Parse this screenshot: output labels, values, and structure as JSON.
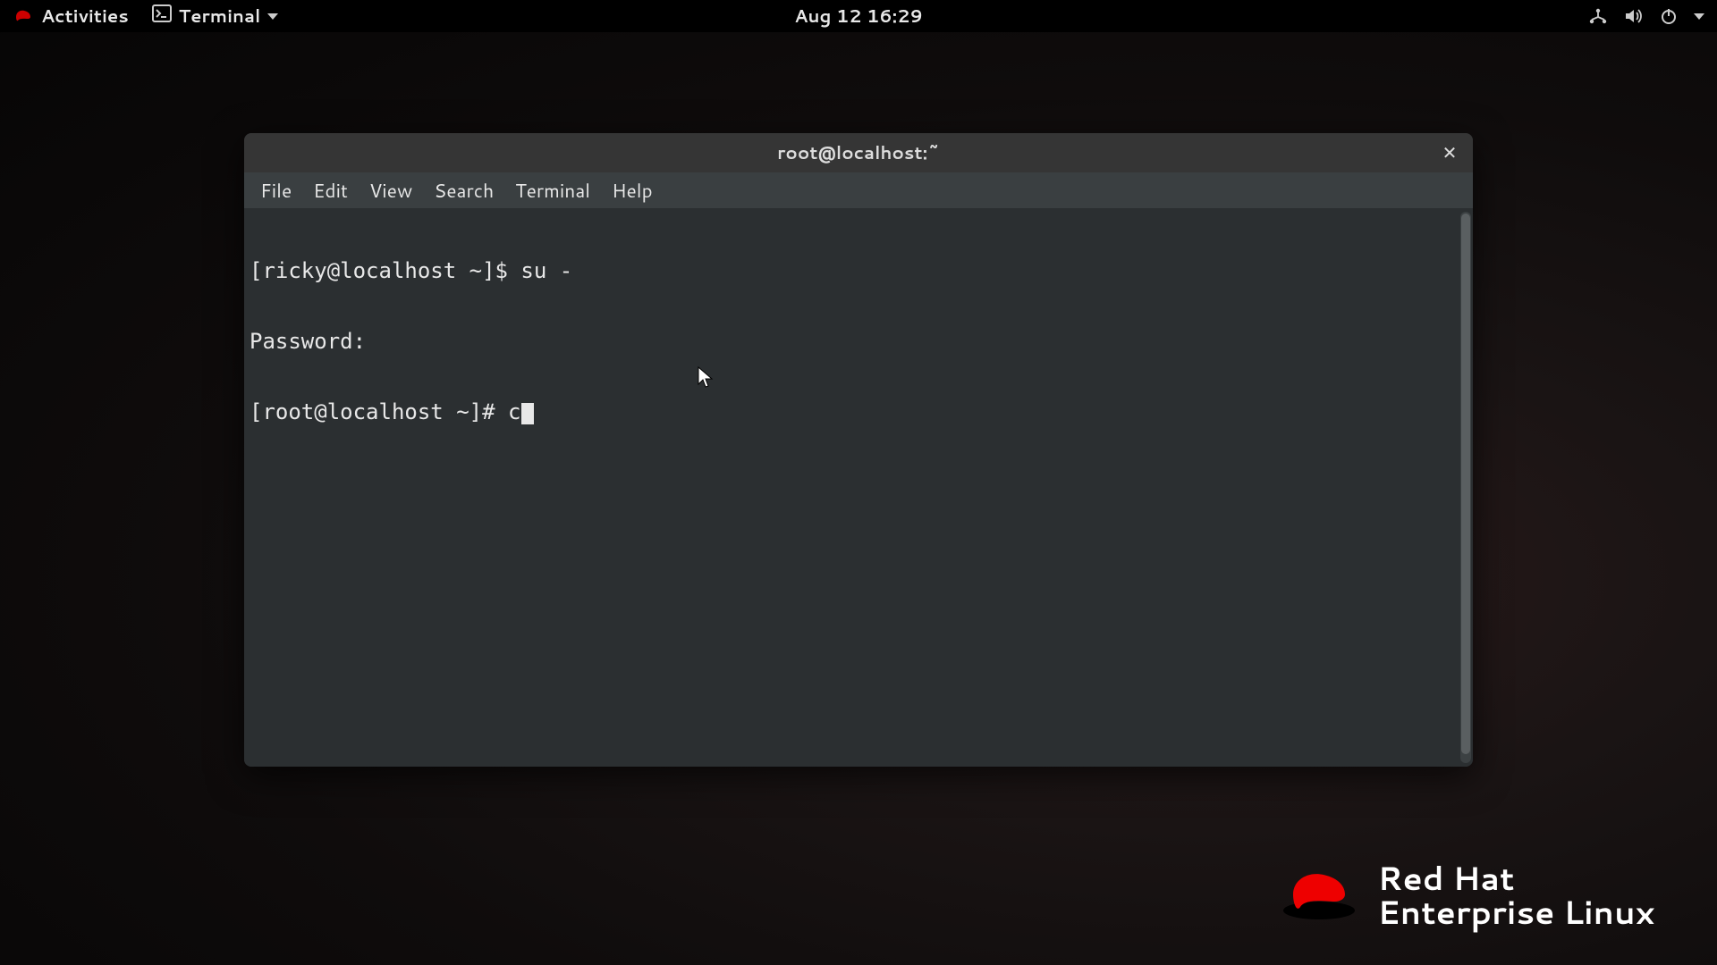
{
  "topbar": {
    "activities": "Activities",
    "app_name": "Terminal",
    "clock": "Aug 12  16:29"
  },
  "window": {
    "title": "root@localhost:~"
  },
  "menubar": {
    "items": [
      "File",
      "Edit",
      "View",
      "Search",
      "Terminal",
      "Help"
    ]
  },
  "terminal": {
    "lines": [
      "[ricky@localhost ~]$ su -",
      "Password:",
      "[root@localhost ~]# c"
    ]
  },
  "brand": {
    "line1": "Red Hat",
    "line2": "Enterprise Linux"
  },
  "colors": {
    "topbar_bg": "#000000",
    "window_bg": "#2e3436",
    "terminal_bg": "#2b2f31",
    "text": "#e8e8e8",
    "brand_red": "#ee0000"
  }
}
